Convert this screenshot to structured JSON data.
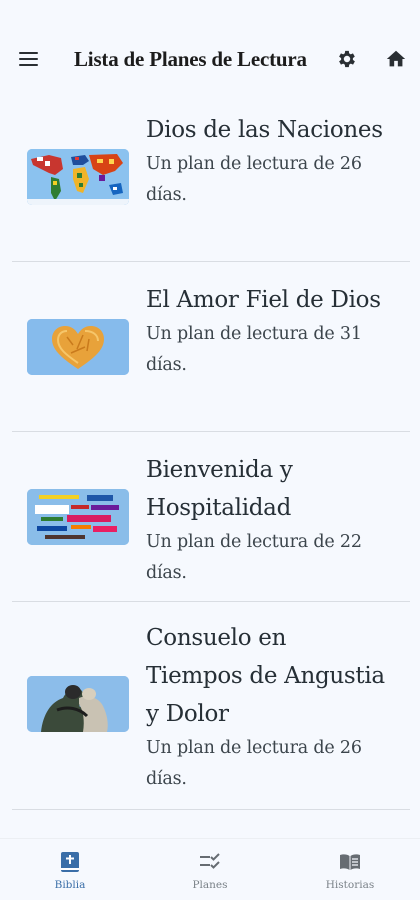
{
  "header": {
    "title": "Lista de Planes de Lectura",
    "menu_icon": "menu-icon",
    "settings_icon": "gear-icon",
    "home_icon": "home-icon"
  },
  "plans": [
    {
      "title": "Dios de las Naciones",
      "description": "Un plan de lectura de 26 días.",
      "image": "world-map-flags"
    },
    {
      "title": "El Amor Fiel de Dios",
      "description": "Un plan de lectura de 31 días.",
      "image": "golden-heart"
    },
    {
      "title": "Bienvenida y Hospitalidad",
      "description": "Un plan de lectura de 22 días.",
      "image": "welcome-word-cloud"
    },
    {
      "title": "Consuelo en Tiempos de Angustia y Dolor",
      "description": "Un plan de lectura de 26 días.",
      "image": "two-people-embracing"
    }
  ],
  "bottom_nav": [
    {
      "label": "Biblia",
      "icon": "bible-icon",
      "active": true
    },
    {
      "label": "Planes",
      "icon": "checklist-icon",
      "active": false
    },
    {
      "label": "Historias",
      "icon": "open-book-icon",
      "active": false
    }
  ],
  "colors": {
    "accent": "#3a6ea8",
    "background": "#f6f9fe",
    "thumb_bg": "#8bbeed"
  }
}
